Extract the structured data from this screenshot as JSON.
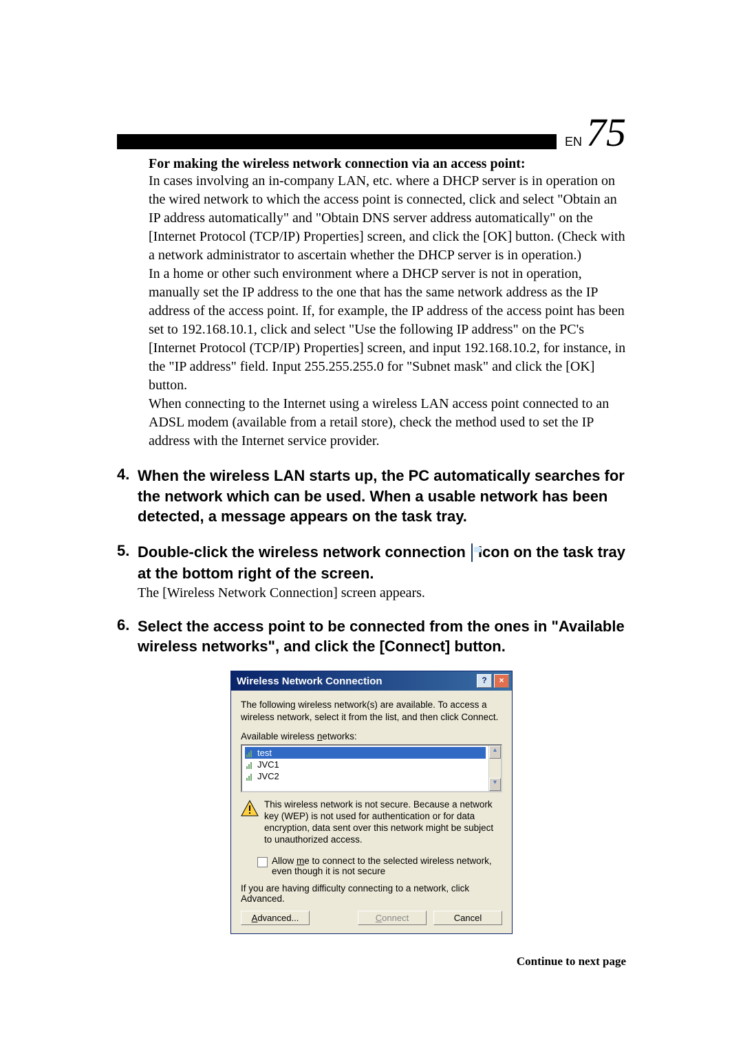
{
  "page_label_small": "EN",
  "page_number": "75",
  "section": {
    "heading": "For making the wireless network connection via an access point:",
    "p1": "In cases involving an in-company LAN, etc. where a DHCP server is in operation on the wired network to which the access point is connected, click and select \"Obtain an IP address automatically\" and \"Obtain DNS server address automatically\" on the [Internet Protocol (TCP/IP) Properties] screen, and click the [OK] button.  (Check with a network administrator to ascertain whether the DHCP server is in operation.)",
    "p2": "In a home or other such environment where a DHCP server is not in operation, manually set the IP address to the one that has the same network address as the IP address of the access point.  If, for example, the IP address of the access point has been set to 192.168.10.1, click and select \"Use the following IP address\" on the PC's [Internet Protocol (TCP/IP) Properties] screen, and input 192.168.10.2, for instance, in the \"IP address\" field.  Input 255.255.255.0 for \"Subnet mask\" and click the [OK] button.",
    "p3": "When connecting to the Internet using a wireless LAN access point connected to an ADSL modem (available from a retail store), check the method used to set the IP address with the Internet service provider."
  },
  "steps": {
    "s4": {
      "num": "4.",
      "text": "When the wireless LAN starts up, the PC automatically searches for the network which can be used.  When a usable network has been detected, a message appears on the task tray."
    },
    "s5": {
      "num": "5.",
      "text_a": "Double-click the wireless network connection",
      "text_b": "icon on the task tray at the bottom right of the screen.",
      "sub": "The [Wireless Network Connection] screen appears."
    },
    "s6": {
      "num": "6.",
      "text": "Select the access point to be connected from the ones in \"Available wireless networks\", and click the [Connect] button."
    }
  },
  "dialog": {
    "title": "Wireless Network Connection",
    "intro": "The following wireless network(s) are available. To access a wireless network, select it from the list, and then click Connect.",
    "list_label_pre": "Available wireless ",
    "list_label_uline": "n",
    "list_label_post": "etworks:",
    "items": [
      "test",
      "JVC1",
      "JVC2"
    ],
    "warning": "This wireless network is not secure. Because a network key (WEP) is not used for authentication or for data encryption, data sent over this network might be subject to unauthorized access.",
    "checkbox_pre": "Allow ",
    "checkbox_uline": "m",
    "checkbox_post": "e to connect to the selected wireless network, even though it is not secure",
    "advanced_text": "If you are having difficulty connecting to a network, click Advanced.",
    "btn_advanced_uline": "A",
    "btn_advanced_post": "dvanced...",
    "btn_connect_uline": "C",
    "btn_connect_post": "onnect",
    "btn_cancel": "Cancel"
  },
  "footer": "Continue to next page"
}
